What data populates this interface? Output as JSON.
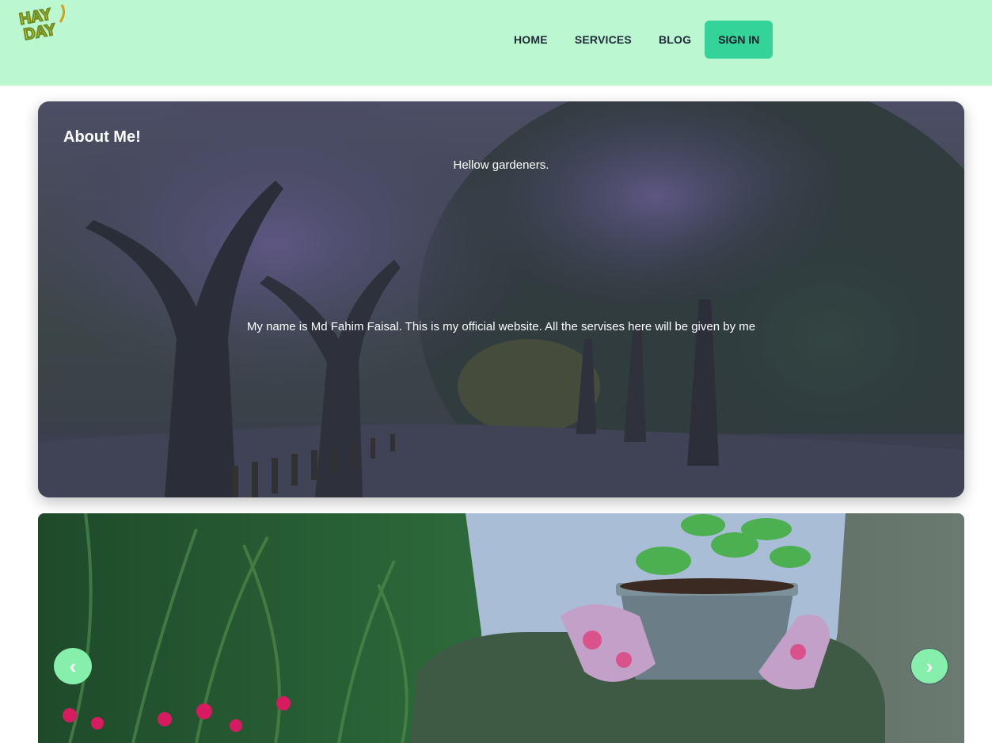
{
  "header": {
    "logo_text": "HAY DAY",
    "nav": [
      "HOME",
      "SERVICES",
      "BLOG"
    ],
    "signin_label": "SIGN IN",
    "bg_color": "#bbf7d0",
    "accent_color": "#34d399"
  },
  "about": {
    "title": "About Me!",
    "greeting": "Hellow gardeners.",
    "body": "My name is Md Fahim Faisal. This is my official website. All the servises here will be given by me"
  },
  "carousel": {
    "prev_label": "‹",
    "next_label": "›",
    "arrow_color": "#86efac"
  }
}
